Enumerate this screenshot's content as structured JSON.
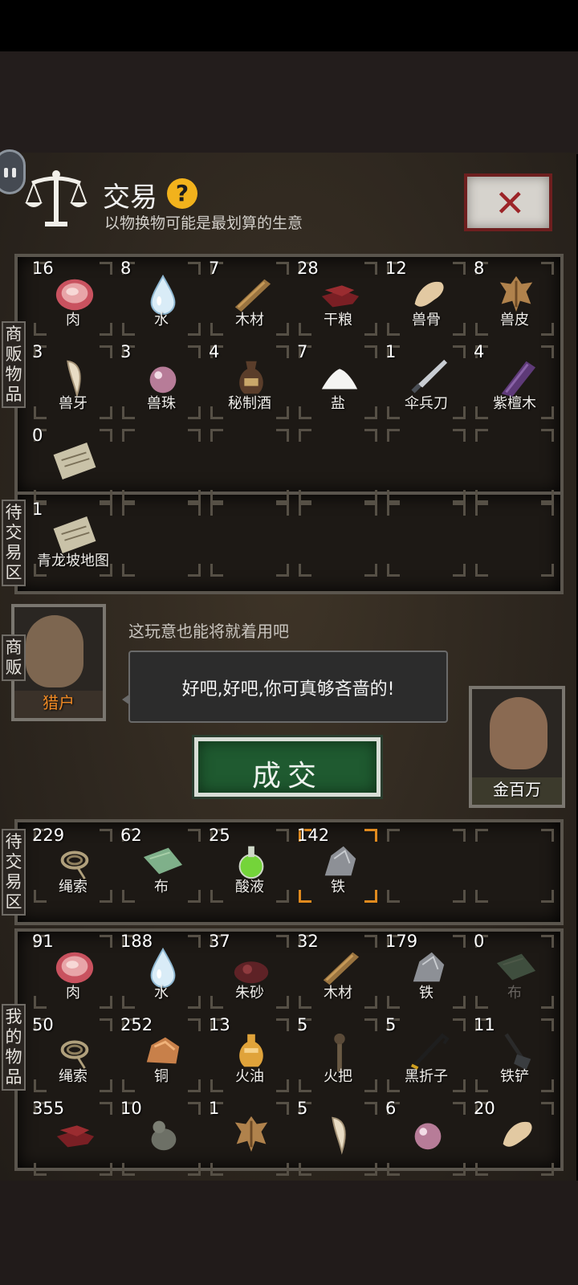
{
  "header": {
    "title": "交易",
    "help_icon": "question-icon",
    "subtitle": "以物换物可能是最划算的生意",
    "close_icon": "close-x-icon"
  },
  "labels": {
    "merchant_items": "商贩物品",
    "pending_top": "待交易区",
    "merchant": "商贩",
    "pending_bottom": "待交易区",
    "my_items": "我的物品"
  },
  "merchant_items": [
    {
      "count": "16",
      "name": "肉",
      "icon": "meat-icon"
    },
    {
      "count": "8",
      "name": "水",
      "icon": "water-drop-icon"
    },
    {
      "count": "7",
      "name": "木材",
      "icon": "wood-plank-icon"
    },
    {
      "count": "28",
      "name": "干粮",
      "icon": "jerky-icon"
    },
    {
      "count": "12",
      "name": "兽骨",
      "icon": "bone-icon"
    },
    {
      "count": "8",
      "name": "兽皮",
      "icon": "hide-icon"
    },
    {
      "count": "3",
      "name": "兽牙",
      "icon": "fang-icon"
    },
    {
      "count": "3",
      "name": "兽珠",
      "icon": "pearl-icon"
    },
    {
      "count": "4",
      "name": "秘制酒",
      "icon": "wine-jar-icon"
    },
    {
      "count": "7",
      "name": "盐",
      "icon": "salt-icon"
    },
    {
      "count": "1",
      "name": "伞兵刀",
      "icon": "knife-icon"
    },
    {
      "count": "4",
      "name": "紫檀木",
      "icon": "rosewood-icon"
    },
    {
      "count": "0",
      "name": "",
      "icon": "map-icon"
    }
  ],
  "pending_top": [
    {
      "count": "1",
      "name": "青龙坡地图",
      "icon": "map-icon"
    }
  ],
  "merchant": {
    "name": "猎户",
    "quote": "这玩意也能将就着用吧",
    "portrait": "hunter-portrait"
  },
  "dialogue": "好吧,好吧,你可真够吝啬的!",
  "deal_button": "成交",
  "player": {
    "name": "金百万",
    "portrait": "player-portrait"
  },
  "pending_bottom": [
    {
      "count": "229",
      "name": "绳索",
      "icon": "rope-icon"
    },
    {
      "count": "62",
      "name": "布",
      "icon": "cloth-icon"
    },
    {
      "count": "25",
      "name": "酸液",
      "icon": "acid-flask-icon"
    },
    {
      "count": "142",
      "name": "铁",
      "icon": "iron-ore-icon"
    }
  ],
  "my_items": [
    {
      "count": "91",
      "name": "肉",
      "icon": "meat-icon"
    },
    {
      "count": "188",
      "name": "水",
      "icon": "water-drop-icon"
    },
    {
      "count": "37",
      "name": "朱砂",
      "icon": "cinnabar-icon"
    },
    {
      "count": "32",
      "name": "木材",
      "icon": "wood-plank-icon"
    },
    {
      "count": "179",
      "name": "铁",
      "icon": "iron-ore-icon"
    },
    {
      "count": "0",
      "name": "布",
      "icon": "cloth-icon"
    },
    {
      "count": "50",
      "name": "绳索",
      "icon": "rope-icon"
    },
    {
      "count": "252",
      "name": "铜",
      "icon": "copper-ore-icon"
    },
    {
      "count": "13",
      "name": "火油",
      "icon": "oil-flask-icon"
    },
    {
      "count": "5",
      "name": "火把",
      "icon": "torch-icon"
    },
    {
      "count": "5",
      "name": "黑折子",
      "icon": "crowbar-icon"
    },
    {
      "count": "11",
      "name": "铁铲",
      "icon": "shovel-icon"
    },
    {
      "count": "355",
      "name": "",
      "icon": "jerky-icon"
    },
    {
      "count": "10",
      "name": "",
      "icon": "gourd-icon"
    },
    {
      "count": "1",
      "name": "",
      "icon": "hide-icon"
    },
    {
      "count": "5",
      "name": "",
      "icon": "fang-icon"
    },
    {
      "count": "6",
      "name": "",
      "icon": "pearl-icon"
    },
    {
      "count": "20",
      "name": "",
      "icon": "bone-icon"
    }
  ]
}
